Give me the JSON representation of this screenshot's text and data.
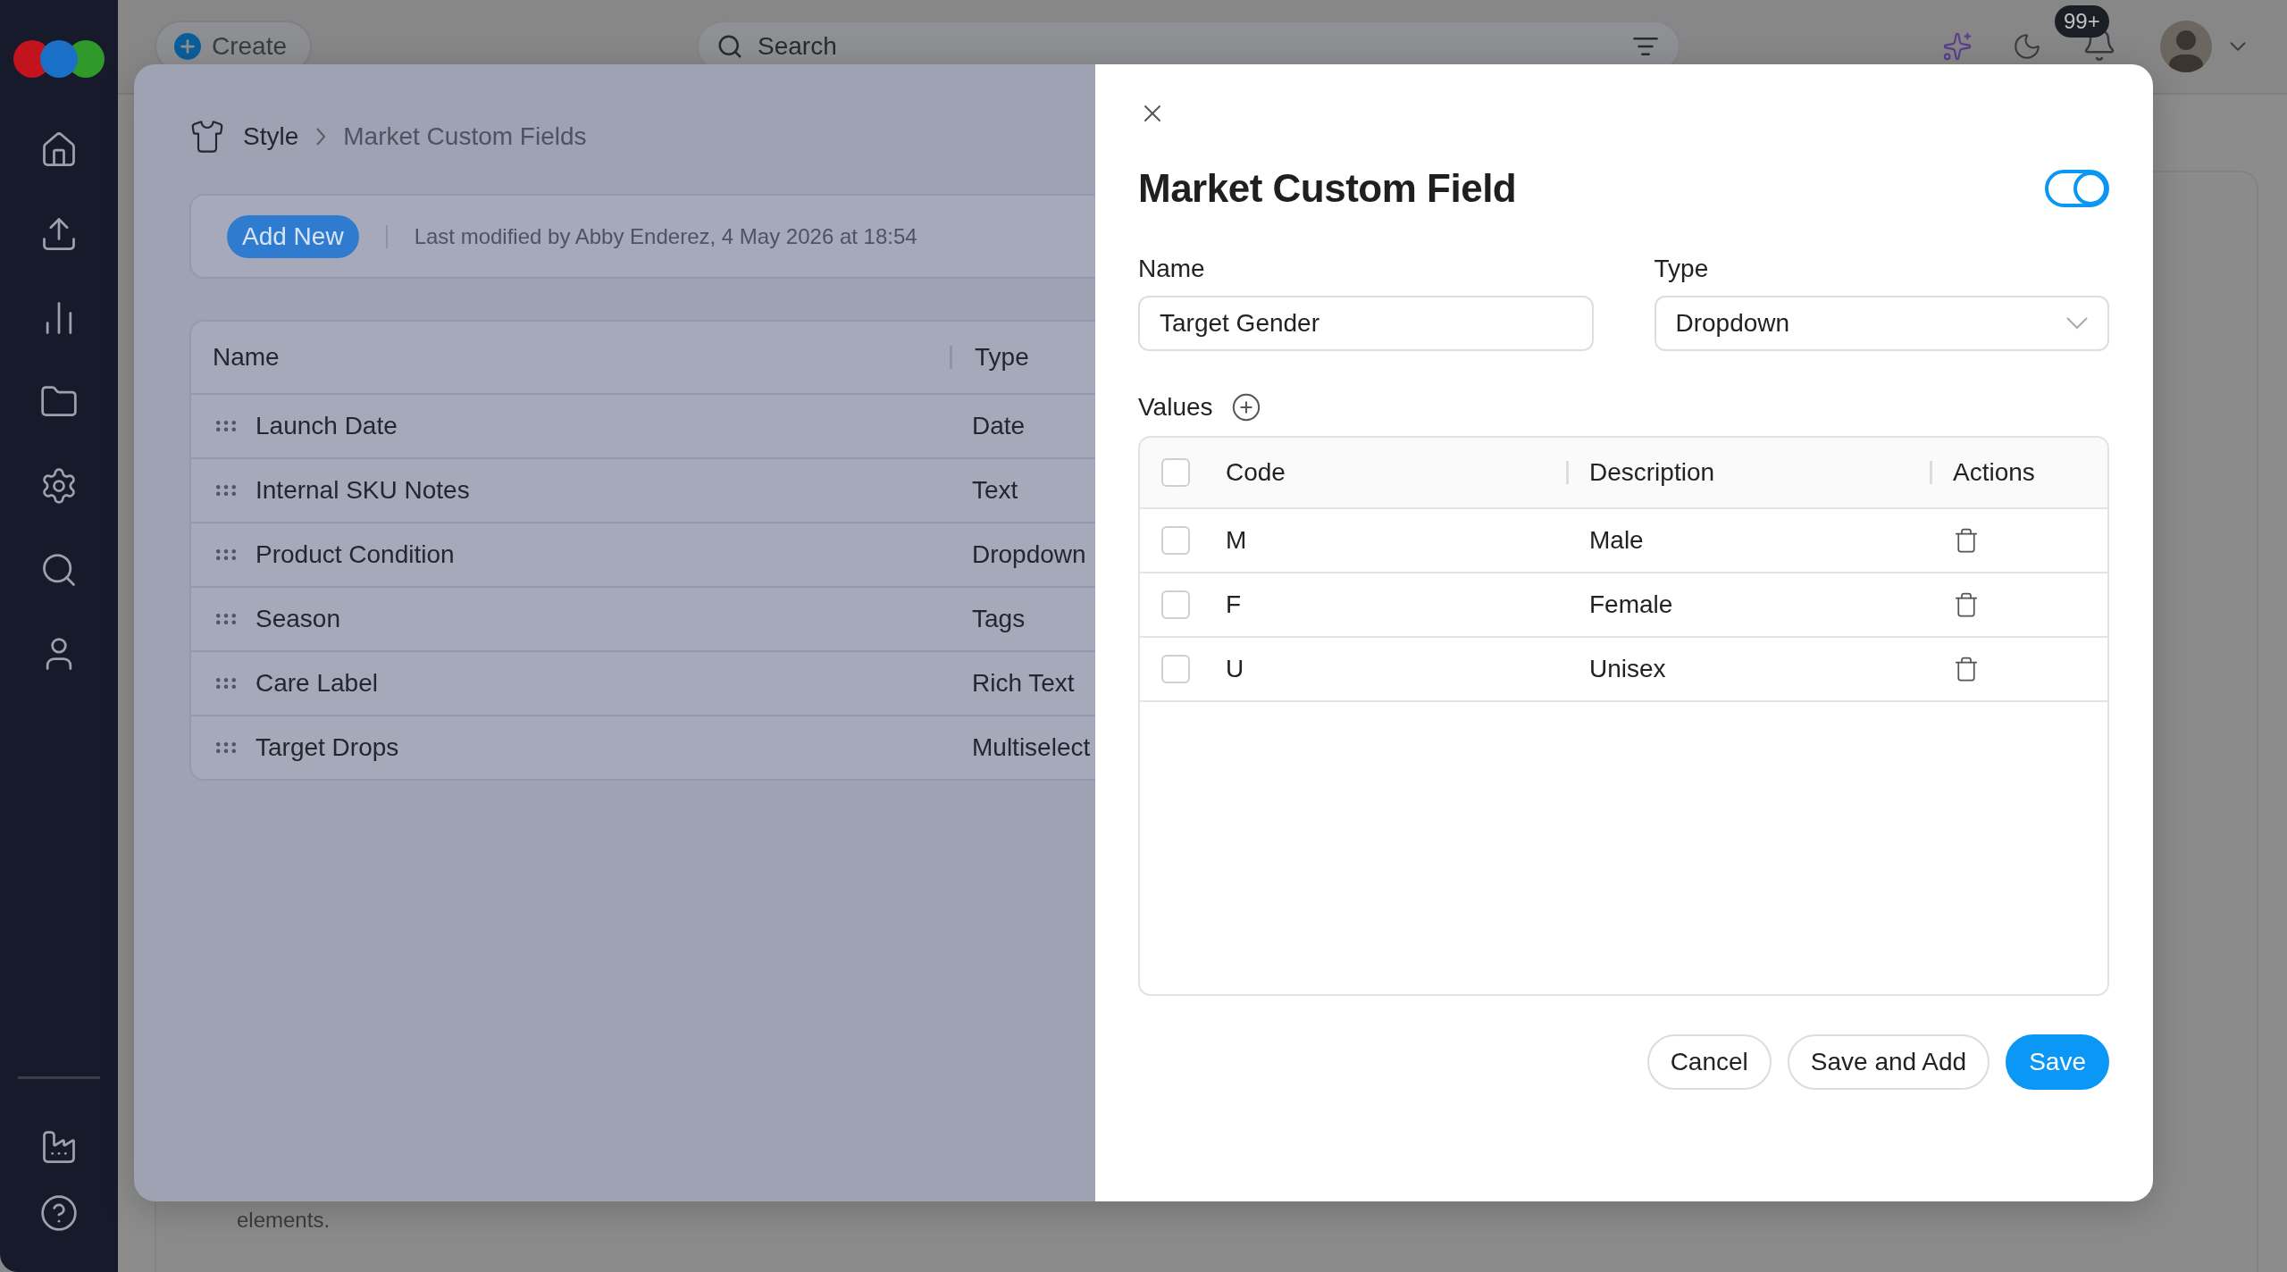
{
  "top_bar": {
    "create_button": "Create",
    "search": {
      "placeholder": "Search"
    },
    "notification_count": "99+"
  },
  "background": {
    "text": "elements."
  },
  "page": {
    "breadcrumb": [
      "Style",
      "Market Custom Fields"
    ],
    "toolbar": {
      "add_button": "Add New",
      "last_modified": "Last modified by Abby Enderez, 4 May 2026 at 18:54"
    },
    "table": {
      "columns": [
        "Name",
        "Type"
      ],
      "rows": [
        {
          "name": "Launch Date",
          "type": "Date"
        },
        {
          "name": "Internal SKU Notes",
          "type": "Text"
        },
        {
          "name": "Product Condition",
          "type": "Dropdown"
        },
        {
          "name": "Season",
          "type": "Tags"
        },
        {
          "name": "Care Label",
          "type": "Rich Text"
        },
        {
          "name": "Target Drops",
          "type": "Multiselect"
        }
      ]
    }
  },
  "drawer": {
    "title": "Market Custom Field",
    "toggle": {
      "on": true
    },
    "name_field": {
      "label": "Name",
      "value": "Target Gender"
    },
    "type_field": {
      "label": "Type",
      "value": "Dropdown"
    },
    "values": {
      "label": "Values",
      "header_checked": false,
      "columns": [
        "Code",
        "Description",
        "Actions"
      ],
      "rows": [
        {
          "code": "M",
          "description": "Male",
          "checked": false
        },
        {
          "code": "F",
          "description": "Female",
          "checked": false
        },
        {
          "code": "U",
          "description": "Unisex",
          "checked": false
        }
      ]
    },
    "buttons": [
      {
        "label": "Cancel",
        "kind": "secondary"
      },
      {
        "label": "Save and Add",
        "kind": "secondary"
      },
      {
        "label": "Save",
        "kind": "primary"
      }
    ]
  }
}
